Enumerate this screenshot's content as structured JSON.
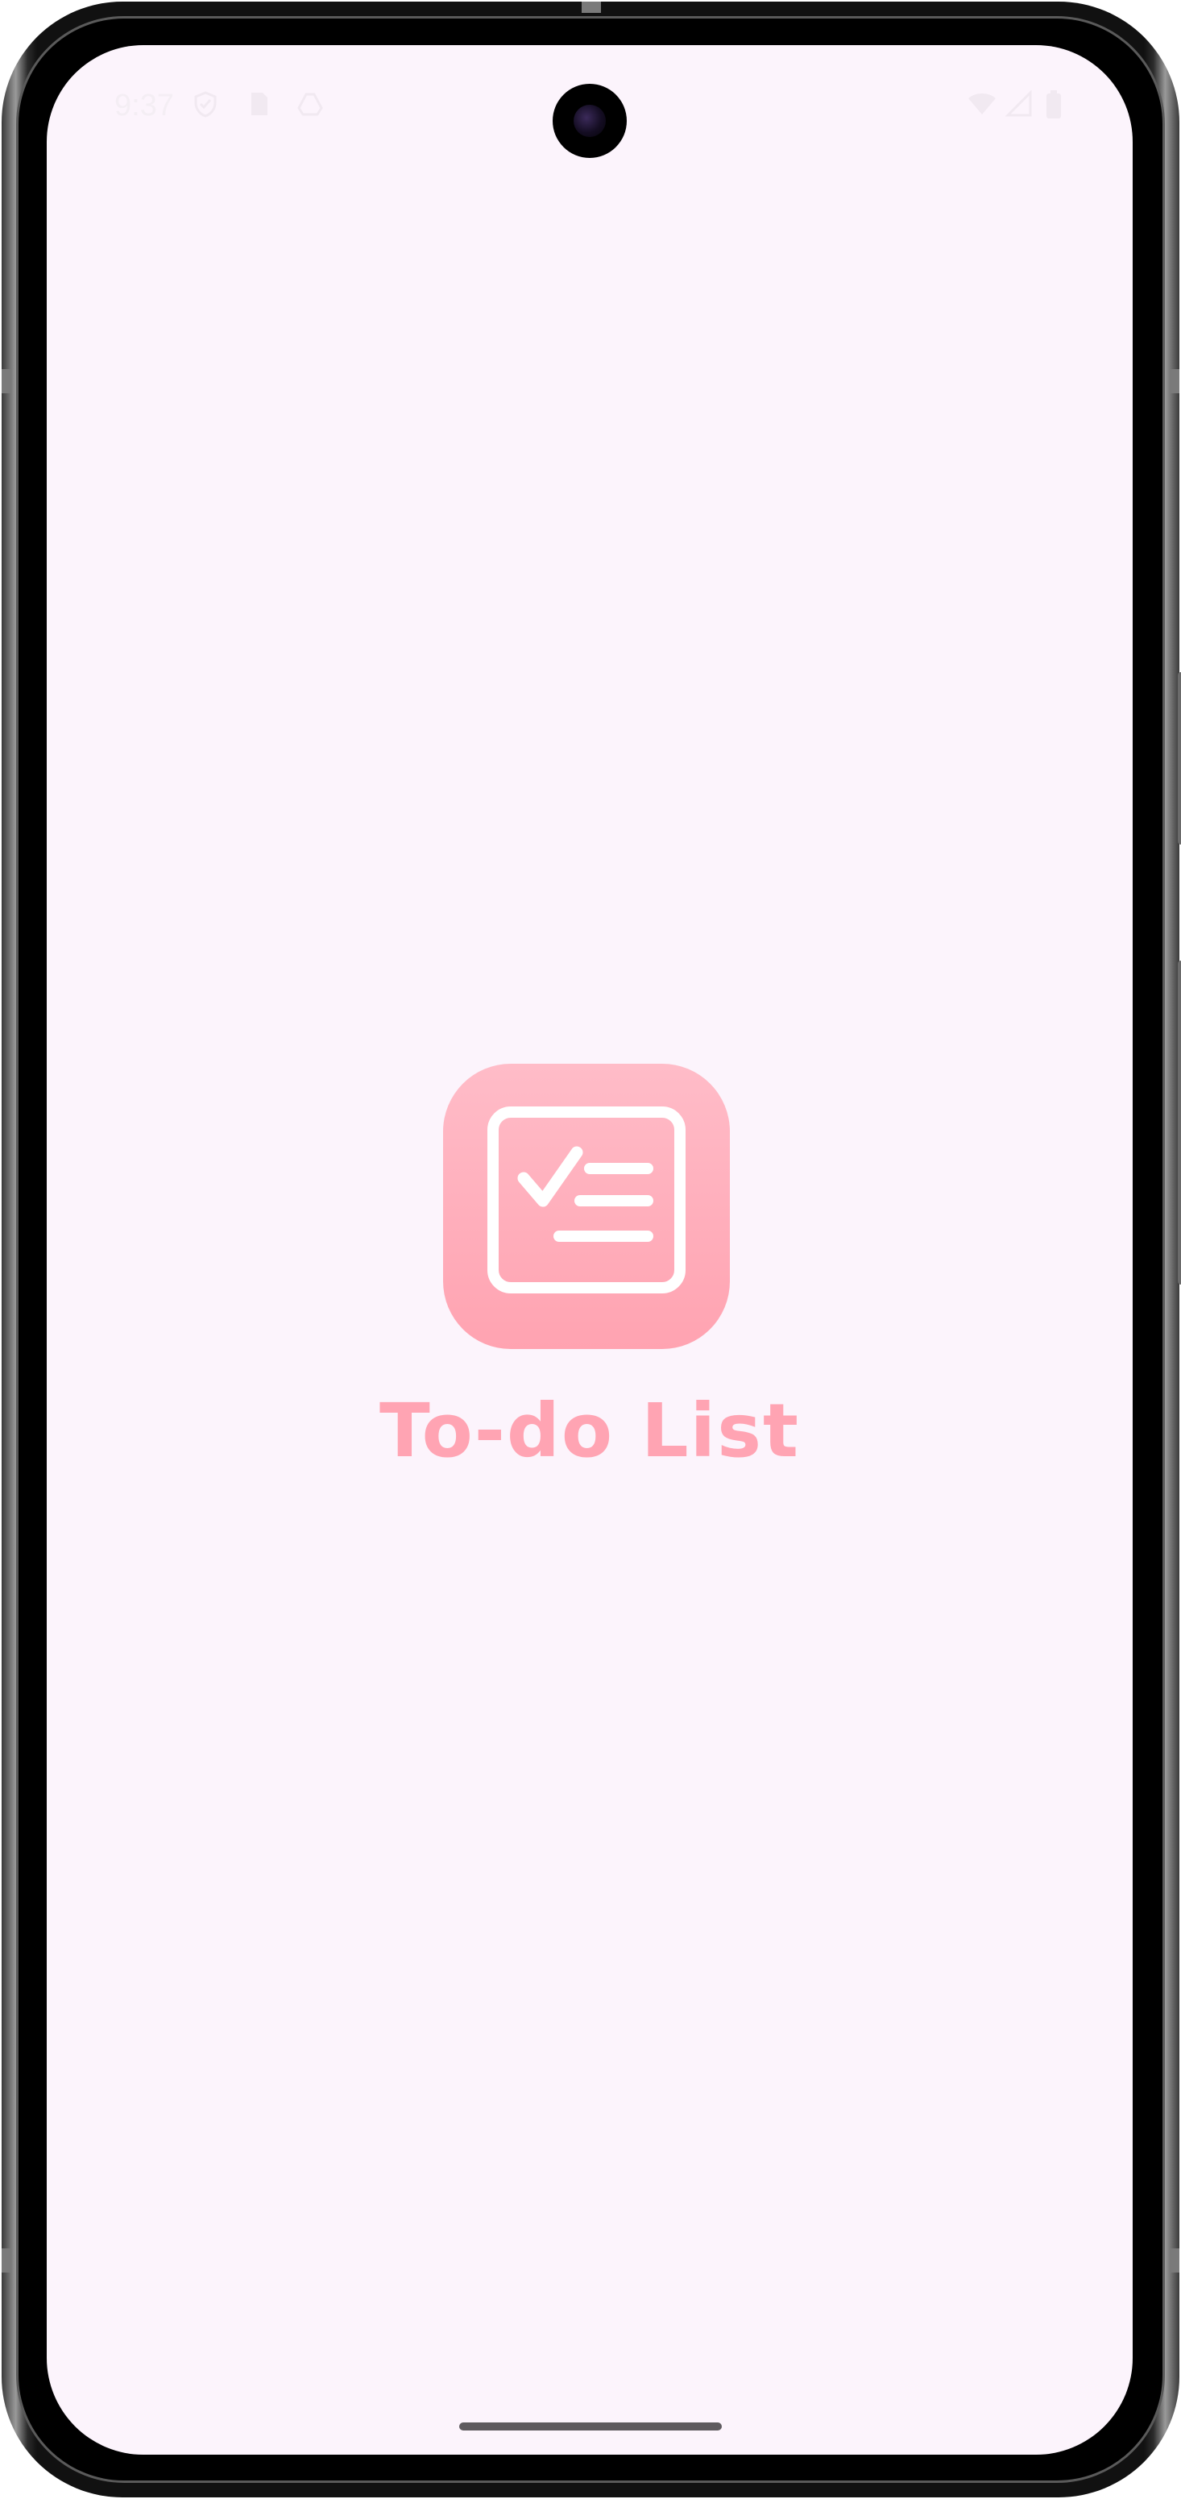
{
  "status_bar": {
    "time": "9:37",
    "left_icons": [
      "shield-icon",
      "sim-card-icon",
      "drive-icon"
    ],
    "right_icons": [
      "wifi-icon",
      "signal-icon",
      "battery-icon"
    ]
  },
  "splash": {
    "app_name": "To-do List",
    "app_icon": "checklist-icon"
  },
  "colors": {
    "screen_background": "#fcf4fc",
    "brand_pink": "#ffa4b3",
    "icon_gradient_top": "#ffbcc8",
    "icon_gradient_bottom": "#ffa3b1"
  }
}
